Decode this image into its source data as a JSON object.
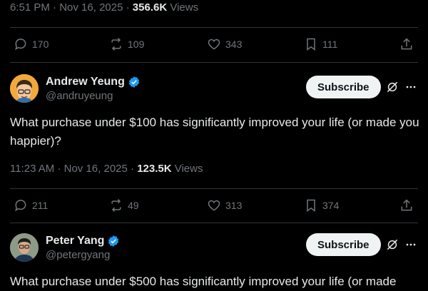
{
  "tweets": [
    {
      "time": "6:51 PM",
      "date": "Nov 16, 2025",
      "views_count": "356.6K",
      "views_label": "Views",
      "stats": {
        "replies": "170",
        "reposts": "109",
        "likes": "343",
        "bookmarks": "111"
      }
    },
    {
      "author_name": "Andrew Yeung",
      "author_handle": "@andruyeung",
      "subscribe_label": "Subscribe",
      "text": "What purchase under $100 has significantly improved your life (or made you happier)?",
      "time": "11:23 AM",
      "date": "Nov 16, 2025",
      "views_count": "123.5K",
      "views_label": "Views",
      "stats": {
        "replies": "211",
        "reposts": "49",
        "likes": "313",
        "bookmarks": "374"
      }
    },
    {
      "author_name": "Peter Yang",
      "author_handle": "@petergyang",
      "subscribe_label": "Subscribe",
      "text": "What purchase under $500 has significantly improved your life (or made"
    }
  ],
  "colors": {
    "background": "#000000",
    "text": "#e7e9ea",
    "muted": "#71767b",
    "verified": "#1d9bf0",
    "divider": "#2f3336"
  }
}
